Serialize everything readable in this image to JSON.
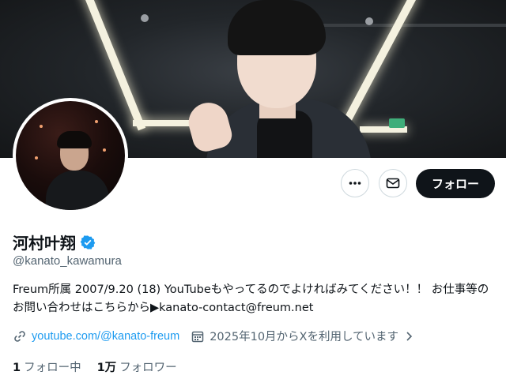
{
  "profile": {
    "name": "河村叶翔",
    "handle": "@kanato_kawamura",
    "bio": "Freum所属 2007/9.20 (18)  YouTubeもやってるのでよければみてください！！ お仕事等のお問い合わせはこちらから▶kanato-contact@freum.net",
    "verified": true,
    "link": "youtube.com/@kanato-freum",
    "joined": "2025年10月からXを利用しています"
  },
  "actions": {
    "more_icon": "more-horizontal-icon",
    "message_icon": "envelope-icon",
    "follow_label": "フォロー"
  },
  "stats": {
    "following_count": "1",
    "following_label": "フォロー中",
    "followers_count": "1万",
    "followers_label": "フォロワー"
  },
  "colors": {
    "accent": "#1d9bf0",
    "follow_button_bg": "#0f1419",
    "secondary_text": "#536471"
  }
}
